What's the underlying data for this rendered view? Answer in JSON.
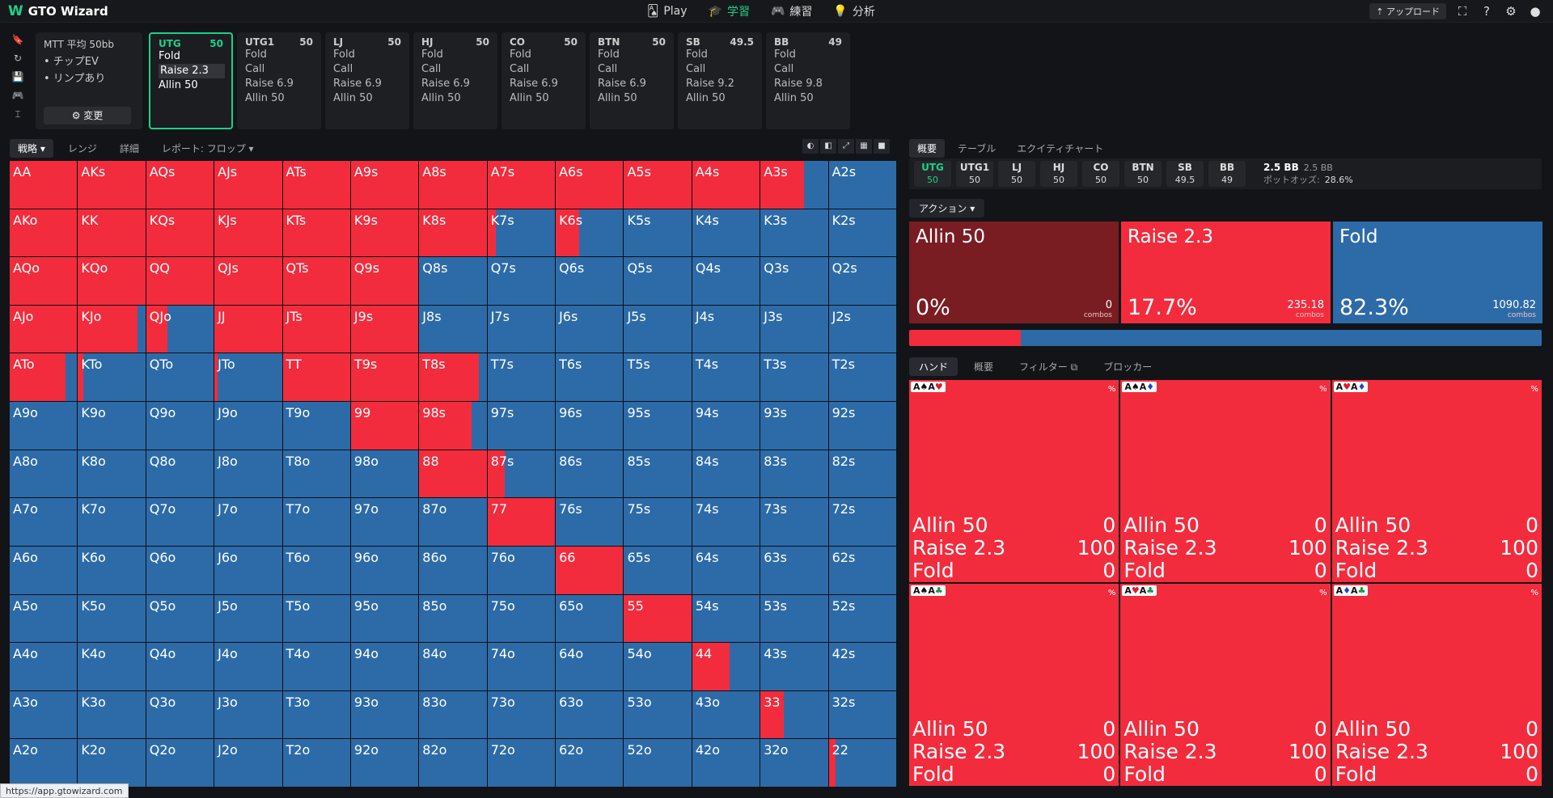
{
  "app": {
    "logo": "GTO Wizard",
    "logo_mark": "W"
  },
  "nav": [
    {
      "label": "Play",
      "icon": "play-cards-icon",
      "glyph": "🂡",
      "active": false
    },
    {
      "label": "学習",
      "icon": "graduation-cap-icon",
      "glyph": "🎓",
      "active": true
    },
    {
      "label": "練習",
      "icon": "gamepad-icon",
      "glyph": "🎮",
      "active": false
    },
    {
      "label": "分析",
      "icon": "lightbulb-icon",
      "glyph": "💡",
      "active": false
    }
  ],
  "topright": {
    "upload": "⇡ アップロード"
  },
  "mtt": {
    "title": "MTT 平均 50bb",
    "bullets": [
      "• チップEV",
      "• リンプあり"
    ],
    "change": "⚙ 変更"
  },
  "positions": [
    {
      "name": "UTG",
      "stack": "50",
      "options": [
        "Fold",
        "Raise 2.3",
        "Allin 50"
      ],
      "selected": true,
      "highlight": 1
    },
    {
      "name": "UTG1",
      "stack": "50",
      "options": [
        "Fold",
        "Call",
        "Raise 6.9",
        "Allin 50"
      ]
    },
    {
      "name": "LJ",
      "stack": "50",
      "options": [
        "Fold",
        "Call",
        "Raise 6.9",
        "Allin 50"
      ]
    },
    {
      "name": "HJ",
      "stack": "50",
      "options": [
        "Fold",
        "Call",
        "Raise 6.9",
        "Allin 50"
      ]
    },
    {
      "name": "CO",
      "stack": "50",
      "options": [
        "Fold",
        "Call",
        "Raise 6.9",
        "Allin 50"
      ]
    },
    {
      "name": "BTN",
      "stack": "50",
      "options": [
        "Fold",
        "Call",
        "Raise 6.9",
        "Allin 50"
      ]
    },
    {
      "name": "SB",
      "stack": "49.5",
      "options": [
        "Fold",
        "Call",
        "Raise 9.2",
        "Allin 50"
      ]
    },
    {
      "name": "BB",
      "stack": "49",
      "options": [
        "Fold",
        "Call",
        "Raise 9.8",
        "Allin 50"
      ]
    }
  ],
  "left_tabs": [
    "戦略 ▾",
    "レンジ",
    "詳細",
    "レポート: フロップ ▾"
  ],
  "right_tabs": [
    "概要",
    "テーブル",
    "エクイティチャート"
  ],
  "pos_bar": [
    {
      "name": "UTG",
      "stack": "50",
      "on": true
    },
    {
      "name": "UTG1",
      "stack": "50"
    },
    {
      "name": "LJ",
      "stack": "50"
    },
    {
      "name": "HJ",
      "stack": "50"
    },
    {
      "name": "CO",
      "stack": "50"
    },
    {
      "name": "BTN",
      "stack": "50"
    },
    {
      "name": "SB",
      "stack": "49.5"
    },
    {
      "name": "BB",
      "stack": "49"
    }
  ],
  "pot": {
    "main": "2.5 BB",
    "sub": "2.5 BB",
    "odds_label": "ポットオッズ:",
    "odds": "28.6%"
  },
  "action_label": "アクション ▾",
  "actions": [
    {
      "name": "Allin 50",
      "pct": "0%",
      "combos": "0",
      "combos_label": "combos",
      "color": "#7a1d22",
      "frac": 0
    },
    {
      "name": "Raise 2.3",
      "pct": "17.7%",
      "combos": "235.18",
      "combos_label": "combos",
      "color": "#f22c3d",
      "frac": 0.177
    },
    {
      "name": "Fold",
      "pct": "82.3%",
      "combos": "1090.82",
      "combos_label": "combos",
      "color": "#2d6ba8",
      "frac": 0.823
    }
  ],
  "hand_tabs": [
    "ハンド",
    "概要",
    "フィルター ⧉",
    "ブロッカー"
  ],
  "combos": [
    {
      "cards": [
        [
          "A",
          "♠",
          "blk"
        ],
        [
          "A",
          "♥",
          "red"
        ]
      ]
    },
    {
      "cards": [
        [
          "A",
          "♠",
          "blk"
        ],
        [
          "A",
          "♦",
          "blu"
        ]
      ]
    },
    {
      "cards": [
        [
          "A",
          "♥",
          "red"
        ],
        [
          "A",
          "♦",
          "blu"
        ]
      ]
    },
    {
      "cards": [
        [
          "A",
          "♠",
          "blk"
        ],
        [
          "A",
          "♣",
          "grn"
        ]
      ]
    },
    {
      "cards": [
        [
          "A",
          "♥",
          "red"
        ],
        [
          "A",
          "♣",
          "grn"
        ]
      ]
    },
    {
      "cards": [
        [
          "A",
          "♦",
          "blu"
        ],
        [
          "A",
          "♣",
          "grn"
        ]
      ]
    }
  ],
  "combo_rows": [
    [
      "Allin 50",
      "0"
    ],
    [
      "Raise 2.3",
      "100"
    ],
    [
      "Fold",
      "0"
    ]
  ],
  "combo_pct_sign": "%",
  "url": "https://app.gtowizard.com",
  "ranks": [
    "A",
    "K",
    "Q",
    "J",
    "T",
    "9",
    "8",
    "7",
    "6",
    "5",
    "4",
    "3",
    "2"
  ],
  "raise_freq": [
    [
      1,
      1,
      1,
      1,
      1,
      1,
      1,
      1,
      1,
      1,
      1,
      0.65,
      0
    ],
    [
      1,
      1,
      1,
      1,
      1,
      1,
      1,
      0.12,
      0.35,
      0,
      0,
      0,
      0
    ],
    [
      1,
      1,
      1,
      1,
      1,
      1,
      0,
      0,
      0,
      0,
      0,
      0,
      0
    ],
    [
      1,
      0.88,
      0.32,
      1,
      1,
      1,
      0,
      0,
      0,
      0,
      0,
      0,
      0
    ],
    [
      0.83,
      0.08,
      0,
      0.05,
      1,
      1,
      0.88,
      0,
      0,
      0,
      0,
      0,
      0
    ],
    [
      0,
      0,
      0,
      0,
      0,
      1,
      0.77,
      0,
      0,
      0,
      0,
      0,
      0
    ],
    [
      0,
      0,
      0,
      0,
      0,
      0,
      1,
      0.25,
      0,
      0,
      0,
      0,
      0
    ],
    [
      0,
      0,
      0,
      0,
      0,
      0,
      0,
      1,
      0,
      0,
      0,
      0,
      0
    ],
    [
      0,
      0,
      0,
      0,
      0,
      0,
      0,
      0,
      1,
      0,
      0,
      0,
      0
    ],
    [
      0,
      0,
      0,
      0,
      0,
      0,
      0,
      0,
      0,
      1,
      0,
      0,
      0
    ],
    [
      0,
      0,
      0,
      0,
      0,
      0,
      0,
      0,
      0,
      0,
      0.55,
      0,
      0
    ],
    [
      0,
      0,
      0,
      0,
      0,
      0,
      0,
      0,
      0,
      0,
      0,
      0.35,
      0
    ],
    [
      0,
      0,
      0,
      0,
      0,
      0,
      0,
      0,
      0,
      0,
      0,
      0,
      0.1
    ]
  ]
}
